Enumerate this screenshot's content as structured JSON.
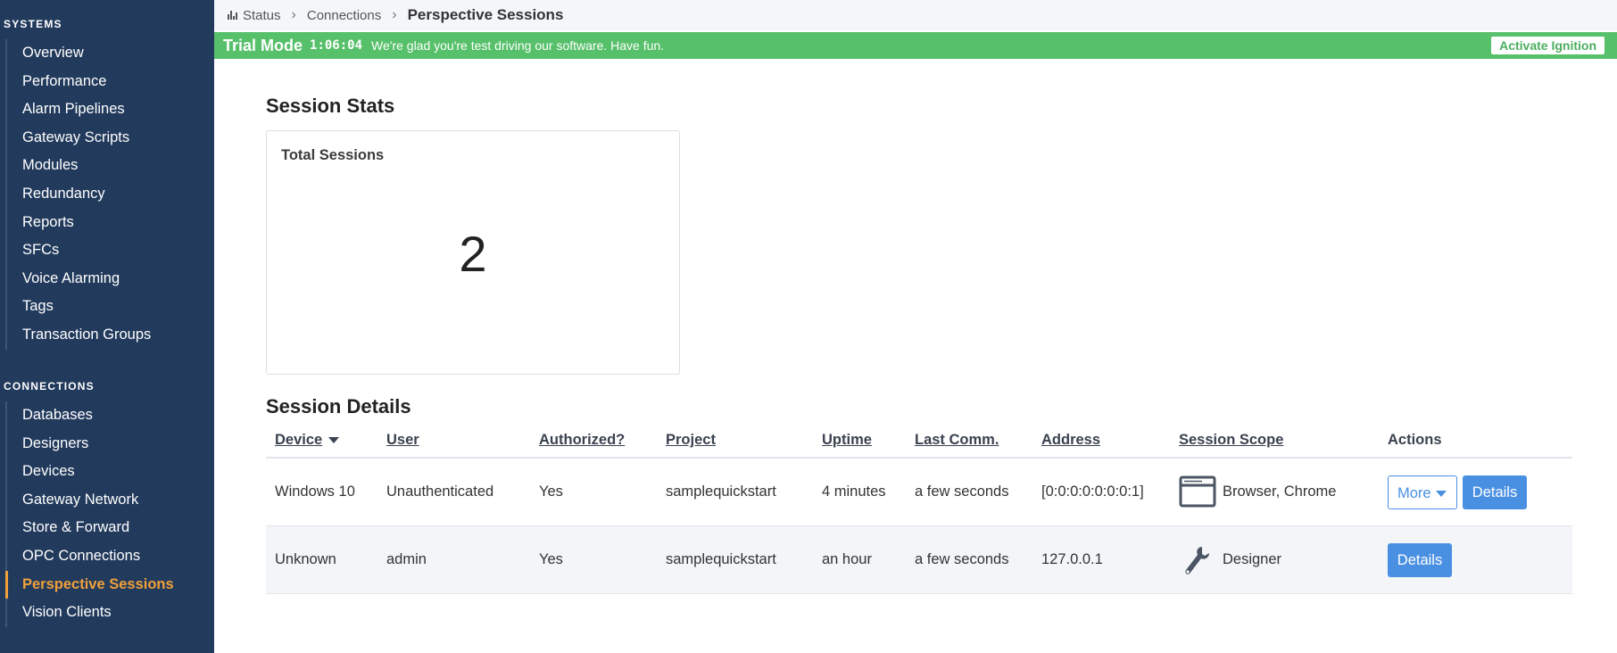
{
  "sidebar": {
    "systems_title": "SYSTEMS",
    "systems_items": [
      {
        "label": "Overview"
      },
      {
        "label": "Performance"
      },
      {
        "label": "Alarm Pipelines"
      },
      {
        "label": "Gateway Scripts"
      },
      {
        "label": "Modules"
      },
      {
        "label": "Redundancy"
      },
      {
        "label": "Reports"
      },
      {
        "label": "SFCs"
      },
      {
        "label": "Voice Alarming"
      },
      {
        "label": "Tags"
      },
      {
        "label": "Transaction Groups"
      }
    ],
    "connections_title": "CONNECTIONS",
    "connections_items": [
      {
        "label": "Databases"
      },
      {
        "label": "Designers"
      },
      {
        "label": "Devices"
      },
      {
        "label": "Gateway Network"
      },
      {
        "label": "Store & Forward"
      },
      {
        "label": "OPC Connections"
      },
      {
        "label": "Perspective Sessions",
        "active": true
      },
      {
        "label": "Vision Clients"
      }
    ]
  },
  "breadcrumb": {
    "items": [
      "Status",
      "Connections"
    ],
    "current": "Perspective Sessions"
  },
  "trial": {
    "title": "Trial Mode",
    "time": "1:06:04",
    "message": "We're glad you're test driving our software. Have fun.",
    "activate_label": "Activate Ignition"
  },
  "stats": {
    "heading": "Session Stats",
    "total_label": "Total Sessions",
    "total_value": "2"
  },
  "details": {
    "heading": "Session Details",
    "columns": [
      "Device",
      "User",
      "Authorized?",
      "Project",
      "Uptime",
      "Last Comm.",
      "Address",
      "Session Scope",
      "Actions"
    ],
    "rows": [
      {
        "device": "Windows 10",
        "user": "Unauthenticated",
        "authorized": "Yes",
        "project": "samplequickstart",
        "uptime": "4 minutes",
        "last_comm": "a few seconds",
        "address": "[0:0:0:0:0:0:0:1]",
        "scope": "Browser, Chrome",
        "scope_icon": "browser-window-icon",
        "more_label": "More",
        "details_label": "Details"
      },
      {
        "device": "Unknown",
        "user": "admin",
        "authorized": "Yes",
        "project": "samplequickstart",
        "uptime": "an hour",
        "last_comm": "a few seconds",
        "address": "127.0.0.1",
        "scope": "Designer",
        "scope_icon": "wrench-icon",
        "details_label": "Details"
      }
    ]
  },
  "colors": {
    "sidebar_bg": "#223a5c",
    "active_nav": "#f0a03a",
    "trial_bg": "#57c06a",
    "primary_button": "#4a90e2"
  }
}
